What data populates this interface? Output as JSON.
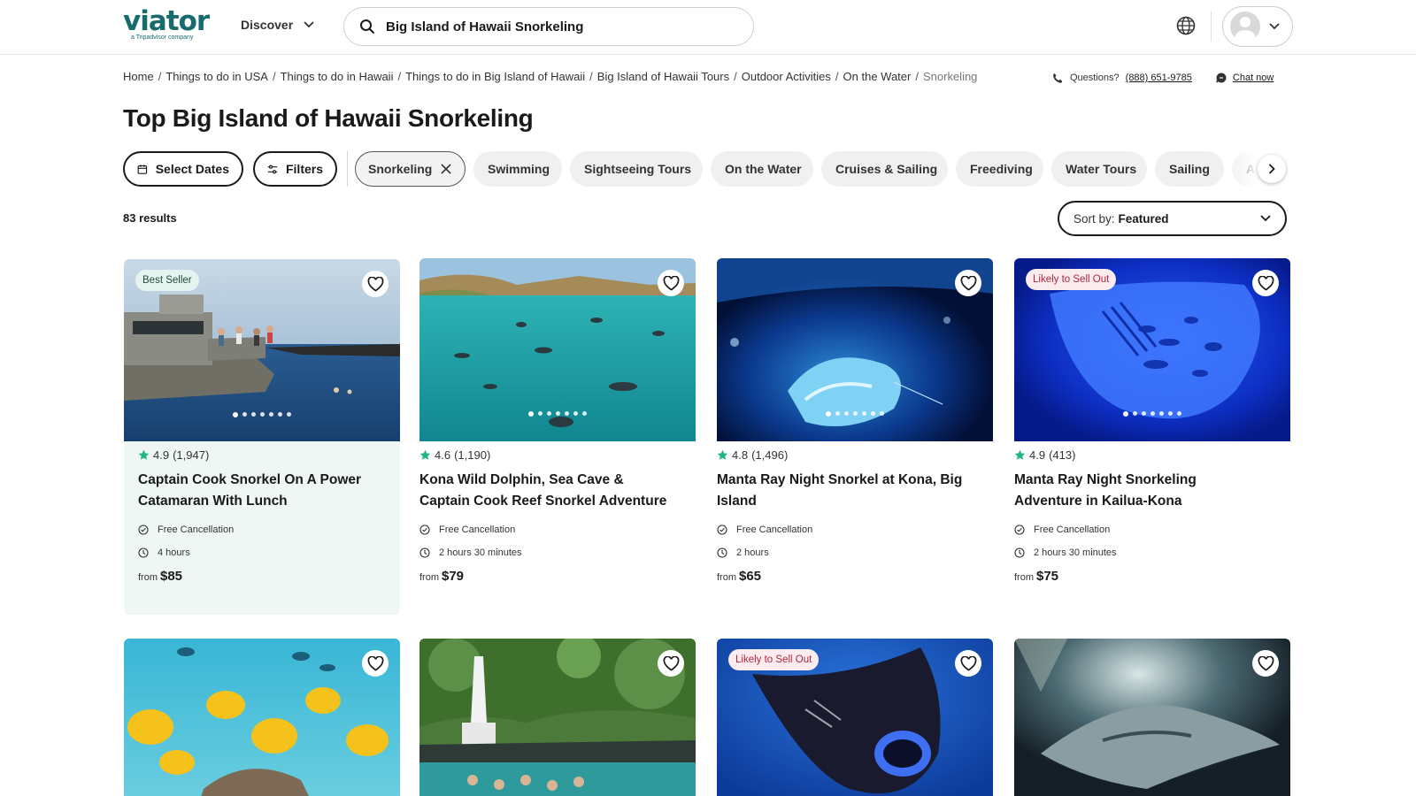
{
  "header": {
    "logo_text": "viator",
    "logo_sub": "a Tripadvisor company",
    "discover_label": "Discover",
    "search_value": "Big Island of Hawaii Snorkeling"
  },
  "breadcrumbs": [
    "Home",
    "Things to do in USA",
    "Things to do in Hawaii",
    "Things to do in Big Island of Hawaii",
    "Big Island of Hawaii Tours",
    "Outdoor Activities",
    "On the Water",
    "Snorkeling"
  ],
  "help": {
    "questions_label": "Questions?",
    "phone": "(888) 651-9785",
    "chat_label": "Chat now"
  },
  "page_title": "Top Big Island of Hawaii Snorkeling",
  "filters": {
    "select_dates": "Select Dates",
    "filters_label": "Filters",
    "active_chip": "Snorkeling",
    "chips": [
      "Swimming",
      "Sightseeing Tours",
      "On the Water",
      "Cruises & Sailing",
      "Freediving",
      "Water Tours",
      "Sailing",
      "Ac"
    ]
  },
  "results_count": "83 results",
  "sort": {
    "label": "Sort by:",
    "value": "Featured"
  },
  "cards": [
    {
      "badge": "Best Seller",
      "rating": "4.9",
      "reviews": "(1,947)",
      "title": "Captain Cook Snorkel On A Power Catamaran With Lunch",
      "cancellation": "Free Cancellation",
      "duration": "4 hours",
      "from": "from",
      "price": "$85"
    },
    {
      "rating": "4.6",
      "reviews": "(1,190)",
      "title": "Kona Wild Dolphin, Sea Cave & Captain Cook Reef Snorkel Adventure",
      "cancellation": "Free Cancellation",
      "duration": "2 hours 30 minutes",
      "from": "from",
      "price": "$79"
    },
    {
      "rating": "4.8",
      "reviews": "(1,496)",
      "title": "Manta Ray Night Snorkel at Kona, Big Island",
      "cancellation": "Free Cancellation",
      "duration": "2 hours",
      "from": "from",
      "price": "$65"
    },
    {
      "badge": "Likely to Sell Out",
      "rating": "4.9",
      "reviews": "(413)",
      "title": "Manta Ray Night Snorkeling Adventure in Kailua-Kona",
      "cancellation": "Free Cancellation",
      "duration": "2 hours 30 minutes",
      "from": "from",
      "price": "$75"
    }
  ],
  "row2_cards": [
    {},
    {},
    {
      "badge": "Likely to Sell Out"
    },
    {}
  ],
  "colors": {
    "brand": "#186b6d",
    "star": "#1fb77e",
    "sell_out": "#b3263d",
    "highlight_bg": "#eff7f5"
  }
}
